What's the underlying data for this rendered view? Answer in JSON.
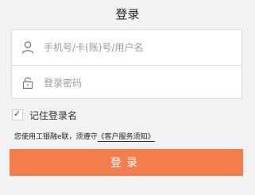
{
  "header": {
    "title": "登录"
  },
  "form": {
    "username": {
      "placeholder": "手机号/卡(账)号/用户名",
      "value": "",
      "icon": "user-icon"
    },
    "password": {
      "placeholder": "登录密码",
      "value": "",
      "icon": "lock-icon"
    }
  },
  "remember": {
    "label": "记住登录名",
    "checked": true,
    "checkmark": "✓"
  },
  "notice": {
    "prefix": "您使用工银融e联，须遵守",
    "link_text": "《客户服务须知》"
  },
  "login_button": {
    "label": "登录"
  },
  "colors": {
    "background": "#f2f2f2",
    "accent": "#f47d4d"
  }
}
